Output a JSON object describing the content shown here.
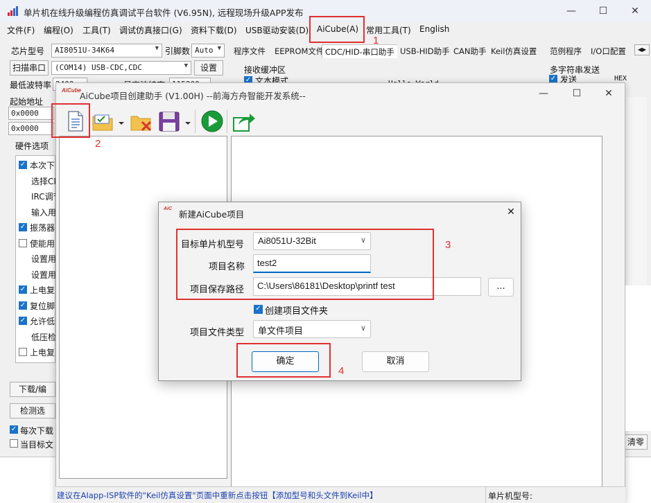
{
  "main": {
    "title": "单片机在线升级编程仿真调试平台软件 (V6.95N), 远程现场升级APP发布",
    "menu": [
      "文件(F)",
      "编程(O)",
      "工具(T)",
      "调试仿真接口(G)",
      "资料下载(D)",
      "USB驱动安装(D)",
      "AiCube(A)",
      "常用工具(T)",
      "English"
    ],
    "chip_label": "芯片型号",
    "chip_value": "AI8051U-34K64",
    "pin_label": "引脚数",
    "pin_value": "Auto",
    "scan_label": "扫描串口",
    "port_value": "(COM14) USB-CDC,CDC",
    "setup_button": "设置",
    "min_baud_label": "最低波特率",
    "min_baud_value": "2400",
    "max_baud_label": "最高波特率",
    "max_baud_value": "115200",
    "start_addr_label": "起始地址",
    "addr1": "0x0000",
    "addr2": "0x0000",
    "hw_options_label": "硬件选项",
    "options": [
      {
        "label": "本次下",
        "checked": true
      },
      {
        "label": "选择CP",
        "checked": null
      },
      {
        "label": "IRC调节",
        "checked": null
      },
      {
        "label": "输入用户",
        "checked": null
      },
      {
        "label": "振荡器",
        "checked": true
      },
      {
        "label": "使能用",
        "checked": false
      },
      {
        "label": "设置用",
        "checked": null
      },
      {
        "label": "设置用",
        "checked": null
      },
      {
        "label": "上电复",
        "checked": true
      },
      {
        "label": "复位脚",
        "checked": true
      },
      {
        "label": "允许低",
        "checked": true
      },
      {
        "label": "低压检",
        "checked": null
      },
      {
        "label": "上电复",
        "checked": false
      }
    ],
    "download_button": "下载/编",
    "detect_button": "检测选",
    "every_download": "每次下载",
    "current_target": "当目标文",
    "tabs": [
      "程序文件",
      "EEPROM文件",
      "CDC/HID-串口助手",
      "USB-HID助手",
      "CAN助手",
      "Keil仿真设置",
      "范例程序",
      "I/O口配置"
    ],
    "recv_buffer": "接收缓冲区",
    "text_mode": "文本模式",
    "recv_text": "Hello World",
    "multi_send": "多字符串发送",
    "send_label": "发送",
    "hex_label": "HEX",
    "clear_button": "清零"
  },
  "aicube": {
    "title": "AiCube项目创建助手 (V1.00H) --前海方舟智能开发系统--",
    "logo": "AiCube",
    "toolbar": [
      "new-project",
      "open-project",
      "close-project",
      "save-project",
      "run",
      "export"
    ]
  },
  "dialog": {
    "title": "新建AiCube项目",
    "mcu_label": "目标单片机型号",
    "mcu_value": "Ai8051U-32Bit",
    "name_label": "项目名称",
    "name_value": "test2",
    "path_label": "项目保存路径",
    "path_value": "C:\\Users\\86181\\Desktop\\printf test",
    "browse_button": "...",
    "create_folder": "创建项目文件夹",
    "type_label": "项目文件类型",
    "type_value": "单文件项目",
    "ok_button": "确定",
    "cancel_button": "取消"
  },
  "annotations": [
    "1",
    "2",
    "3",
    "4"
  ],
  "status": {
    "hint": "建议在AIapp-ISP软件的\"Keil仿真设置\"页面中重新点击按钮【添加型号和头文件到Keil中】",
    "mcu_label": "单片机型号:"
  },
  "colors": {
    "annotation": "#e03030",
    "accent": "#0067c0",
    "check": "#1a73c8"
  }
}
